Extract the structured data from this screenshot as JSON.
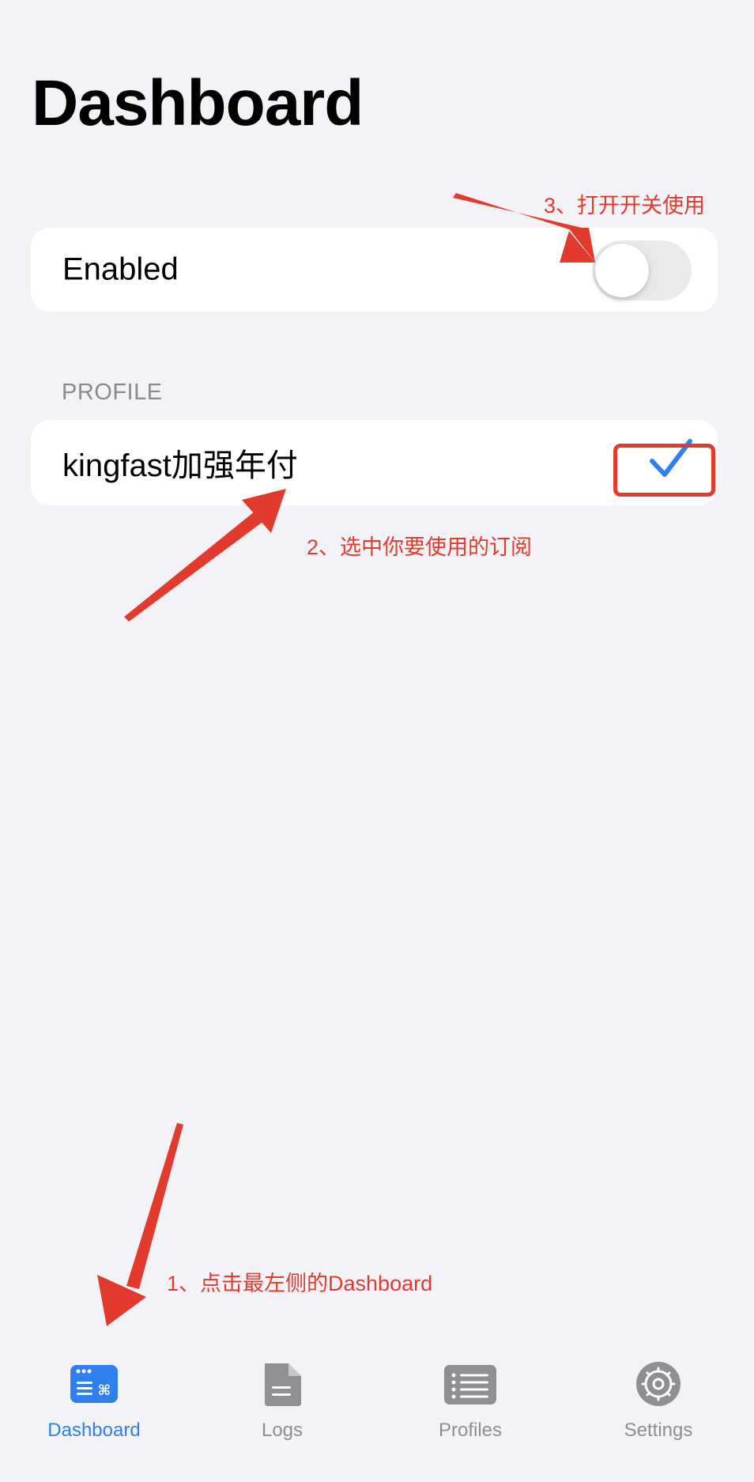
{
  "page": {
    "title": "Dashboard"
  },
  "enabled_row": {
    "label": "Enabled",
    "toggle_on": false
  },
  "profile_section": {
    "header": "PROFILE",
    "items": [
      {
        "name": "kingfast加强年付",
        "selected": true
      }
    ]
  },
  "annotations": {
    "step1": "1、点击最左侧的Dashboard",
    "step2": "2、选中你要使用的订阅",
    "step3": "3、打开开关使用"
  },
  "tab_bar": {
    "tabs": [
      {
        "label": "Dashboard",
        "icon": "dashboard-icon",
        "active": true
      },
      {
        "label": "Logs",
        "icon": "document-icon",
        "active": false
      },
      {
        "label": "Profiles",
        "icon": "list-icon",
        "active": false
      },
      {
        "label": "Settings",
        "icon": "gear-icon",
        "active": false
      }
    ]
  },
  "colors": {
    "accent": "#2f80ed",
    "annotation": "#e23b2e",
    "background": "#f2f2f7",
    "inactive": "#8e8e93"
  }
}
